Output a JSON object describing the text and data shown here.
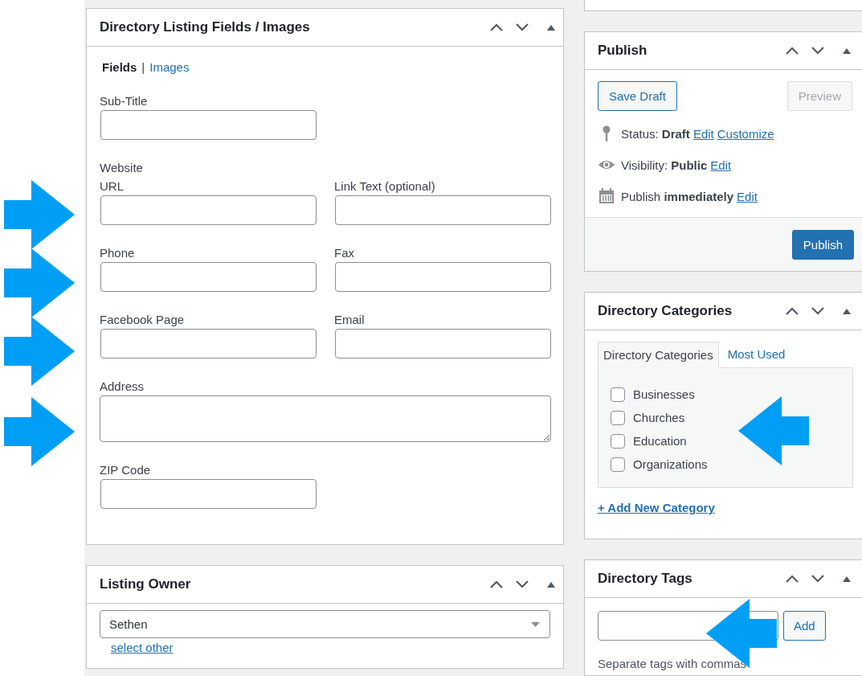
{
  "listing_fields": {
    "title": "Directory Listing Fields / Images",
    "tabs": [
      {
        "label": "Fields",
        "selected": true
      },
      {
        "label": "Images",
        "selected": false
      }
    ],
    "tab_separator": "|",
    "rows": [
      {
        "fields": [
          {
            "label": "Sub-Title",
            "kind": "input"
          }
        ]
      },
      {
        "heading": "Website",
        "fields": [
          {
            "label": "URL",
            "kind": "input"
          },
          {
            "label": "Link Text (optional)",
            "kind": "input"
          }
        ]
      },
      {
        "fields": [
          {
            "label": "Phone",
            "kind": "input"
          },
          {
            "label": "Fax",
            "kind": "input"
          }
        ]
      },
      {
        "fields": [
          {
            "label": "Facebook Page",
            "kind": "input"
          },
          {
            "label": "Email",
            "kind": "input"
          }
        ]
      },
      {
        "fields": [
          {
            "label": "Address",
            "kind": "textarea"
          }
        ]
      },
      {
        "fields": [
          {
            "label": "ZIP Code",
            "kind": "input"
          }
        ]
      }
    ]
  },
  "listing_owner": {
    "title": "Listing Owner",
    "value": "Sethen",
    "link": "select other"
  },
  "publish": {
    "title": "Publish",
    "save_draft": {
      "label": "Save Draft",
      "disabled": false
    },
    "preview": {
      "label": "Preview",
      "disabled": true
    },
    "rows": [
      {
        "kind": "status",
        "text": "Status: **Draft**",
        "links": [
          "Edit",
          "Customize"
        ]
      },
      {
        "kind": "visibility",
        "text": "Visibility: **Public**",
        "links": [
          "Edit"
        ]
      },
      {
        "kind": "schedule",
        "text": "Publish **immediately**",
        "links": [
          "Edit"
        ]
      }
    ],
    "publish_button": "Publish"
  },
  "categories": {
    "title": "Directory Categories",
    "tabs": [
      {
        "label": "Directory Categories",
        "selected": true
      },
      {
        "label": "Most Used",
        "selected": false
      }
    ],
    "items": [
      {
        "label": "Businesses",
        "checked": false
      },
      {
        "label": "Churches",
        "checked": false
      },
      {
        "label": "Education",
        "checked": false
      },
      {
        "label": "Organizations",
        "checked": false
      }
    ],
    "add_link": "+ Add New Category"
  },
  "tags": {
    "title": "Directory Tags",
    "button": "Add",
    "hint": "Separate tags with commas"
  }
}
